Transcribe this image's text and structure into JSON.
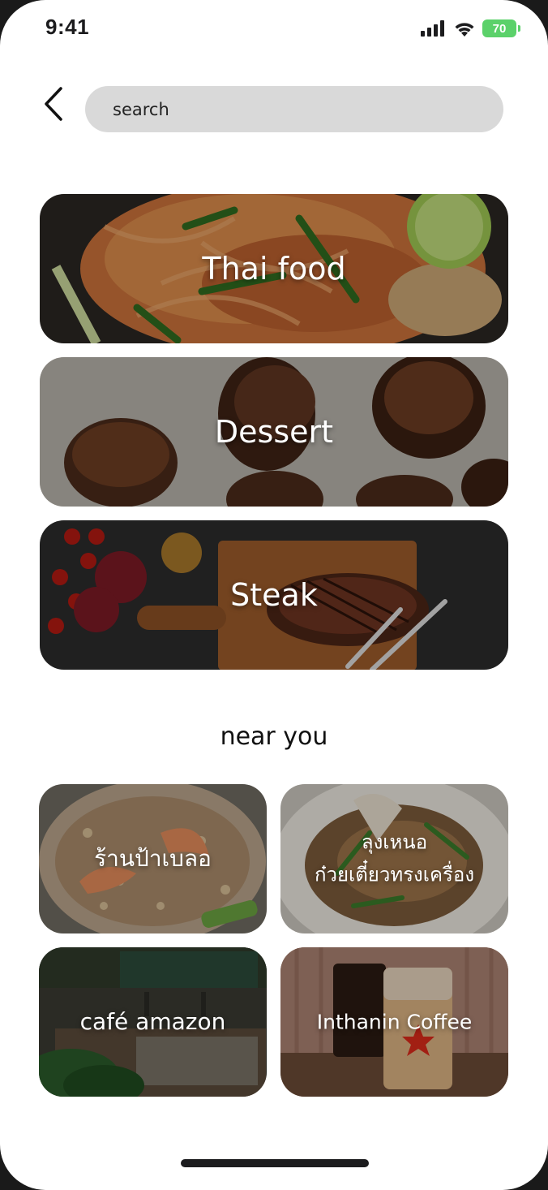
{
  "status_bar": {
    "time": "9:41",
    "battery": "70"
  },
  "header": {
    "search_placeholder": "search"
  },
  "categories": [
    {
      "label": "Thai food"
    },
    {
      "label": "Dessert"
    },
    {
      "label": "Steak"
    }
  ],
  "near_you": {
    "title": "near you",
    "shops": [
      {
        "label": "ร้านป้าเบลอ"
      },
      {
        "label_line1": "ลุงเหนอ",
        "label_line2": "ก๋วยเตี๋ยวทรงเครื่อง"
      },
      {
        "label": "café amazon"
      },
      {
        "label": "Inthanin Coffee"
      }
    ]
  },
  "colors": {
    "search_bg": "#d9d9d9",
    "battery": "#5bd16a",
    "text": "#111111"
  }
}
